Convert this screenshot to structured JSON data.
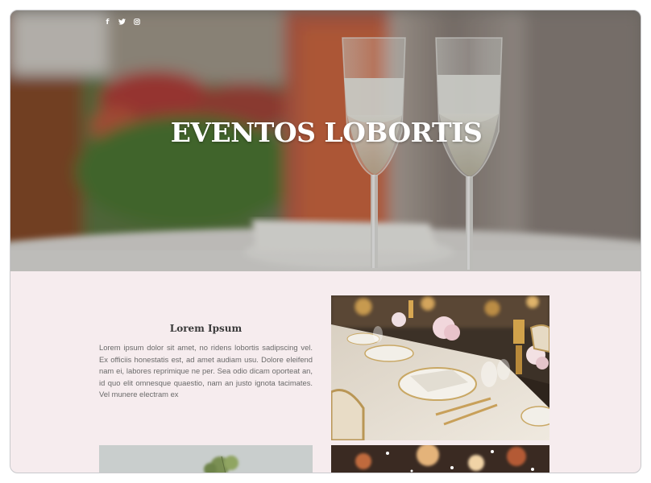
{
  "social": {
    "facebook": "f",
    "twitter": "t",
    "instagram": "◎"
  },
  "hero": {
    "title": "EVENTOS LOBORTIS"
  },
  "section": {
    "title": "Lorem Ipsum",
    "body": "Lorem ipsum dolor sit amet, no ridens lobortis sadipscing vel. Ex officiis honestatis est, ad amet audiam usu. Dolore eleifend nam ei, labores reprimique ne per. Sea odio dicam oporteat an, id quo elit omnesque quaestio, nam an justo ignota tacimates. Vel munere electram ex"
  },
  "colors": {
    "background": "#f6ecee",
    "title": "#3a3a3a",
    "body_text": "#6a6a6a"
  },
  "icons": [
    "facebook-icon",
    "twitter-icon",
    "instagram-icon"
  ]
}
